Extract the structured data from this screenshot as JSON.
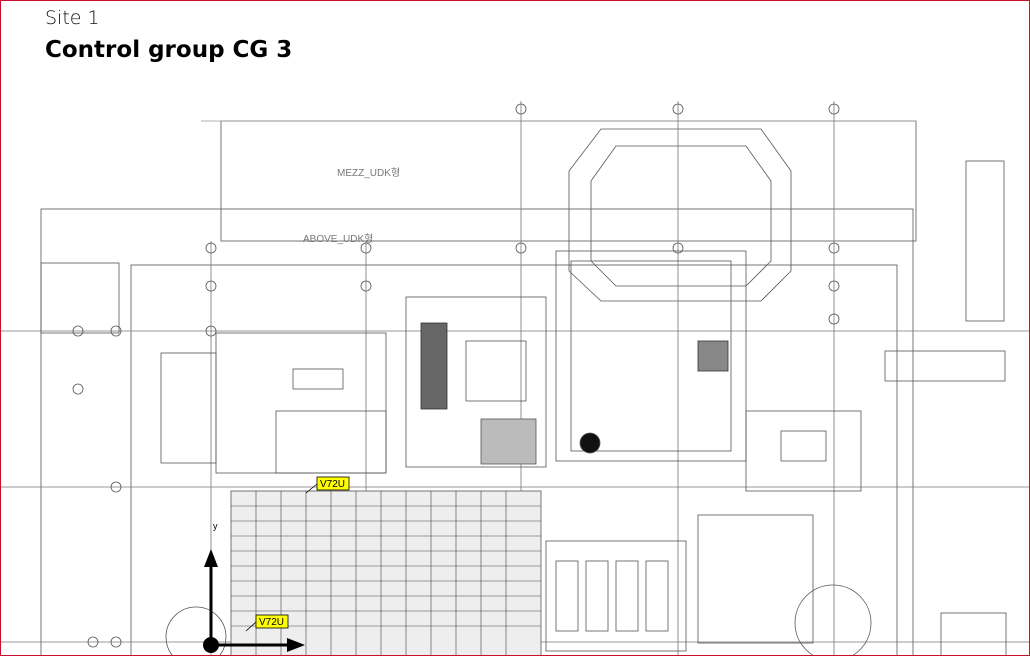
{
  "header": {
    "site": "Site 1",
    "title": "Control group CG 3"
  },
  "drawing": {
    "room_labels": [
      "MEZZ_UDK형",
      "ABOVE_UDK형"
    ],
    "markers": [
      {
        "label": "V72U"
      },
      {
        "label": "V72U"
      }
    ],
    "axis_label": "y",
    "colors": {
      "frame": "#c8102e",
      "marker_fill": "#ffff00",
      "line": "#555555"
    }
  }
}
